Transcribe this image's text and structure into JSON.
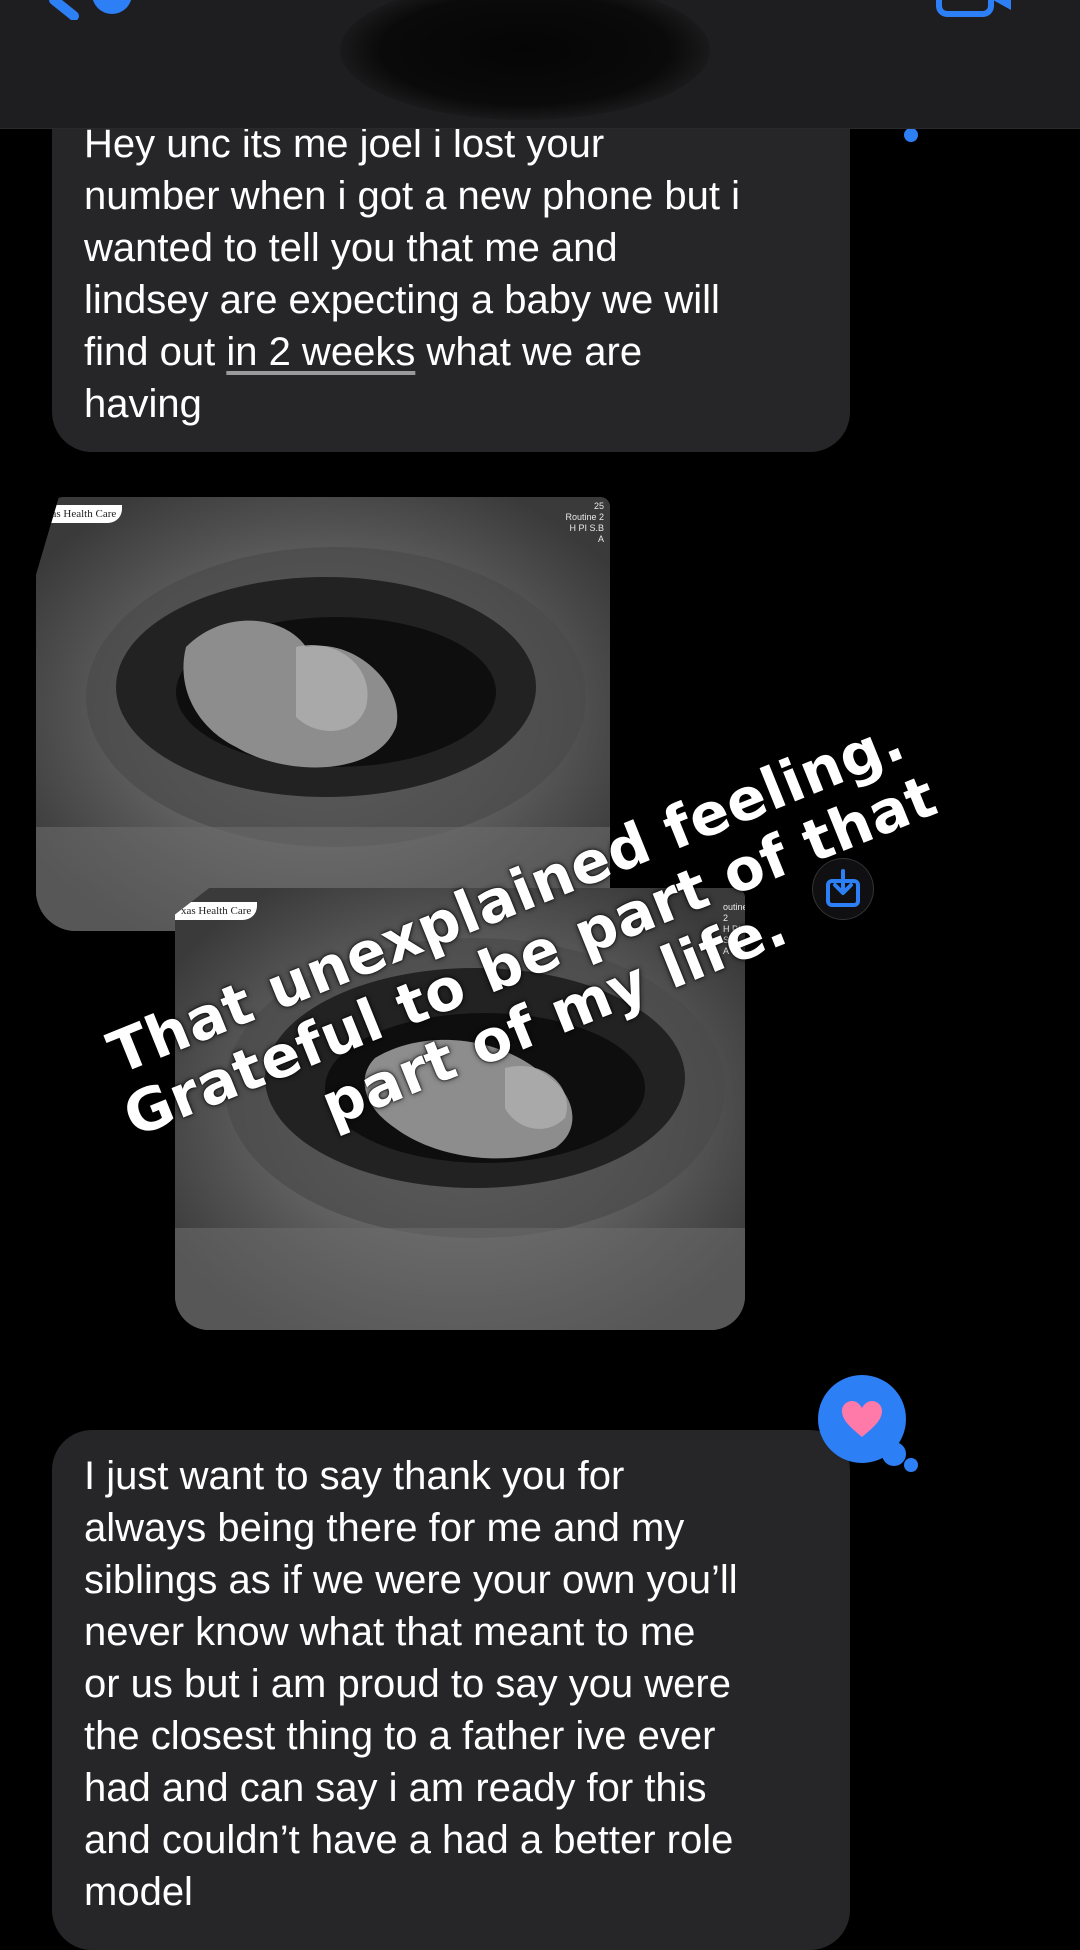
{
  "header": {
    "back_icon": "chevron-left-icon",
    "video_icon": "video-camera-icon"
  },
  "messages": [
    {
      "text_before_link": "Hey unc its me joel i lost your\nnumber when i got a new phone but i\nwanted to tell you that me and\nlindsey are expecting a baby we will\nfind out ",
      "link_text": "in 2 weeks",
      "text_after_link": " what we are\nhaving"
    },
    {
      "text": "I just want to say thank you for\nalways being there for me and my\nsiblings as if we were your own you’ll\nnever know what that meant to me\nor us but i am proud to say you were\nthe closest thing to a father ive ever\nhad and can say i am ready for this\nand couldn’t have a had a better role\nmodel",
      "reaction": "heart"
    }
  ],
  "images": [
    {
      "label": "xas Health Care",
      "meta": "25\nRoutine 2\nH PI S.B\nA"
    },
    {
      "label": "xas Health Care",
      "meta": "outine 2\nH PI S.B\nA"
    }
  ],
  "overlay": {
    "line1": "That unexplained feeling.",
    "line2": "Grateful to be part of that",
    "line3": "part of my life."
  },
  "colors": {
    "accent": "#2d7ff5",
    "bubble": "#262628",
    "heart": "#ff7aa8"
  }
}
